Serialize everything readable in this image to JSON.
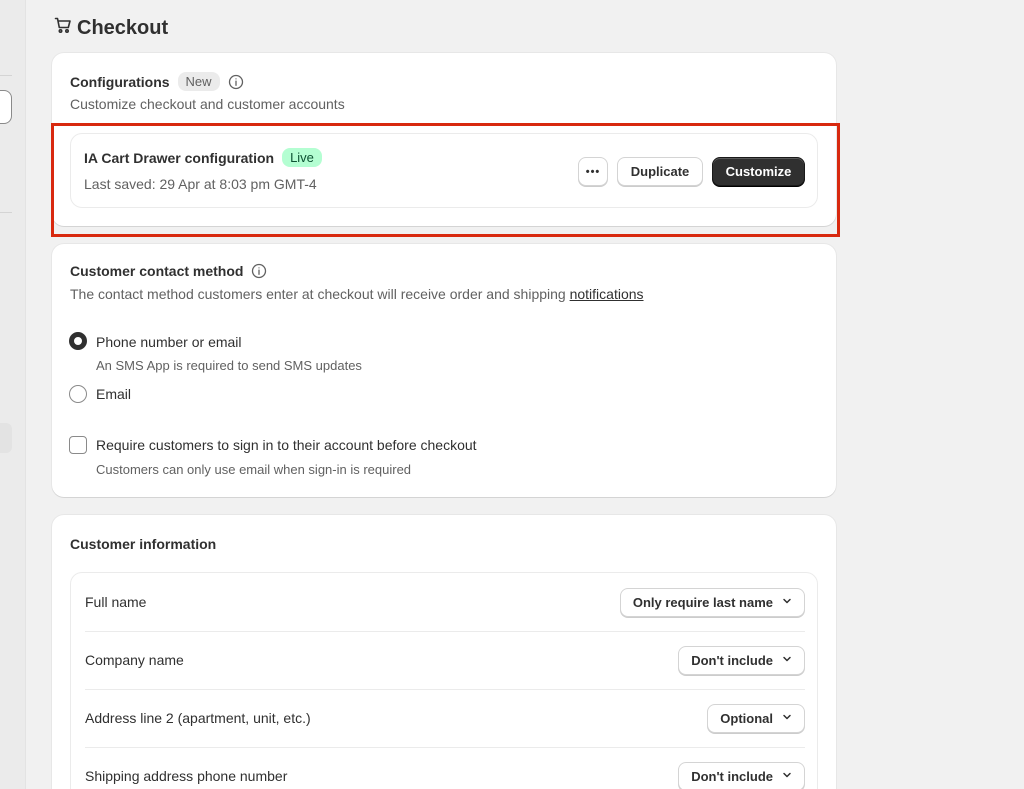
{
  "page": {
    "title": "Checkout"
  },
  "configurations": {
    "title": "Configurations",
    "badge": "New",
    "subtitle": "Customize checkout and customer accounts",
    "item": {
      "name": "IA Cart Drawer configuration",
      "status": "Live",
      "last_saved": "Last saved: 29 Apr at 8:03 pm GMT-4",
      "more_label": "•••",
      "duplicate_label": "Duplicate",
      "customize_label": "Customize"
    }
  },
  "contact_method": {
    "title": "Customer contact method",
    "description_prefix": "The contact method customers enter at checkout will receive order and shipping ",
    "description_link": "notifications",
    "options": [
      {
        "label": "Phone number or email",
        "help": "An SMS App is required to send SMS updates",
        "selected": true
      },
      {
        "label": "Email",
        "help": "",
        "selected": false
      }
    ],
    "signin": {
      "label": "Require customers to sign in to their account before checkout",
      "help": "Customers can only use email when sign-in is required",
      "checked": false
    }
  },
  "customer_info": {
    "title": "Customer information",
    "rows": [
      {
        "label": "Full name",
        "value": "Only require last name"
      },
      {
        "label": "Company name",
        "value": "Don't include"
      },
      {
        "label": "Address line 2 (apartment, unit, etc.)",
        "value": "Optional"
      },
      {
        "label": "Shipping address phone number",
        "value": "Don't include"
      }
    ]
  },
  "colors": {
    "highlight": "#d8290f",
    "live_badge_bg": "#b4fed2",
    "primary_button": "#303030"
  }
}
